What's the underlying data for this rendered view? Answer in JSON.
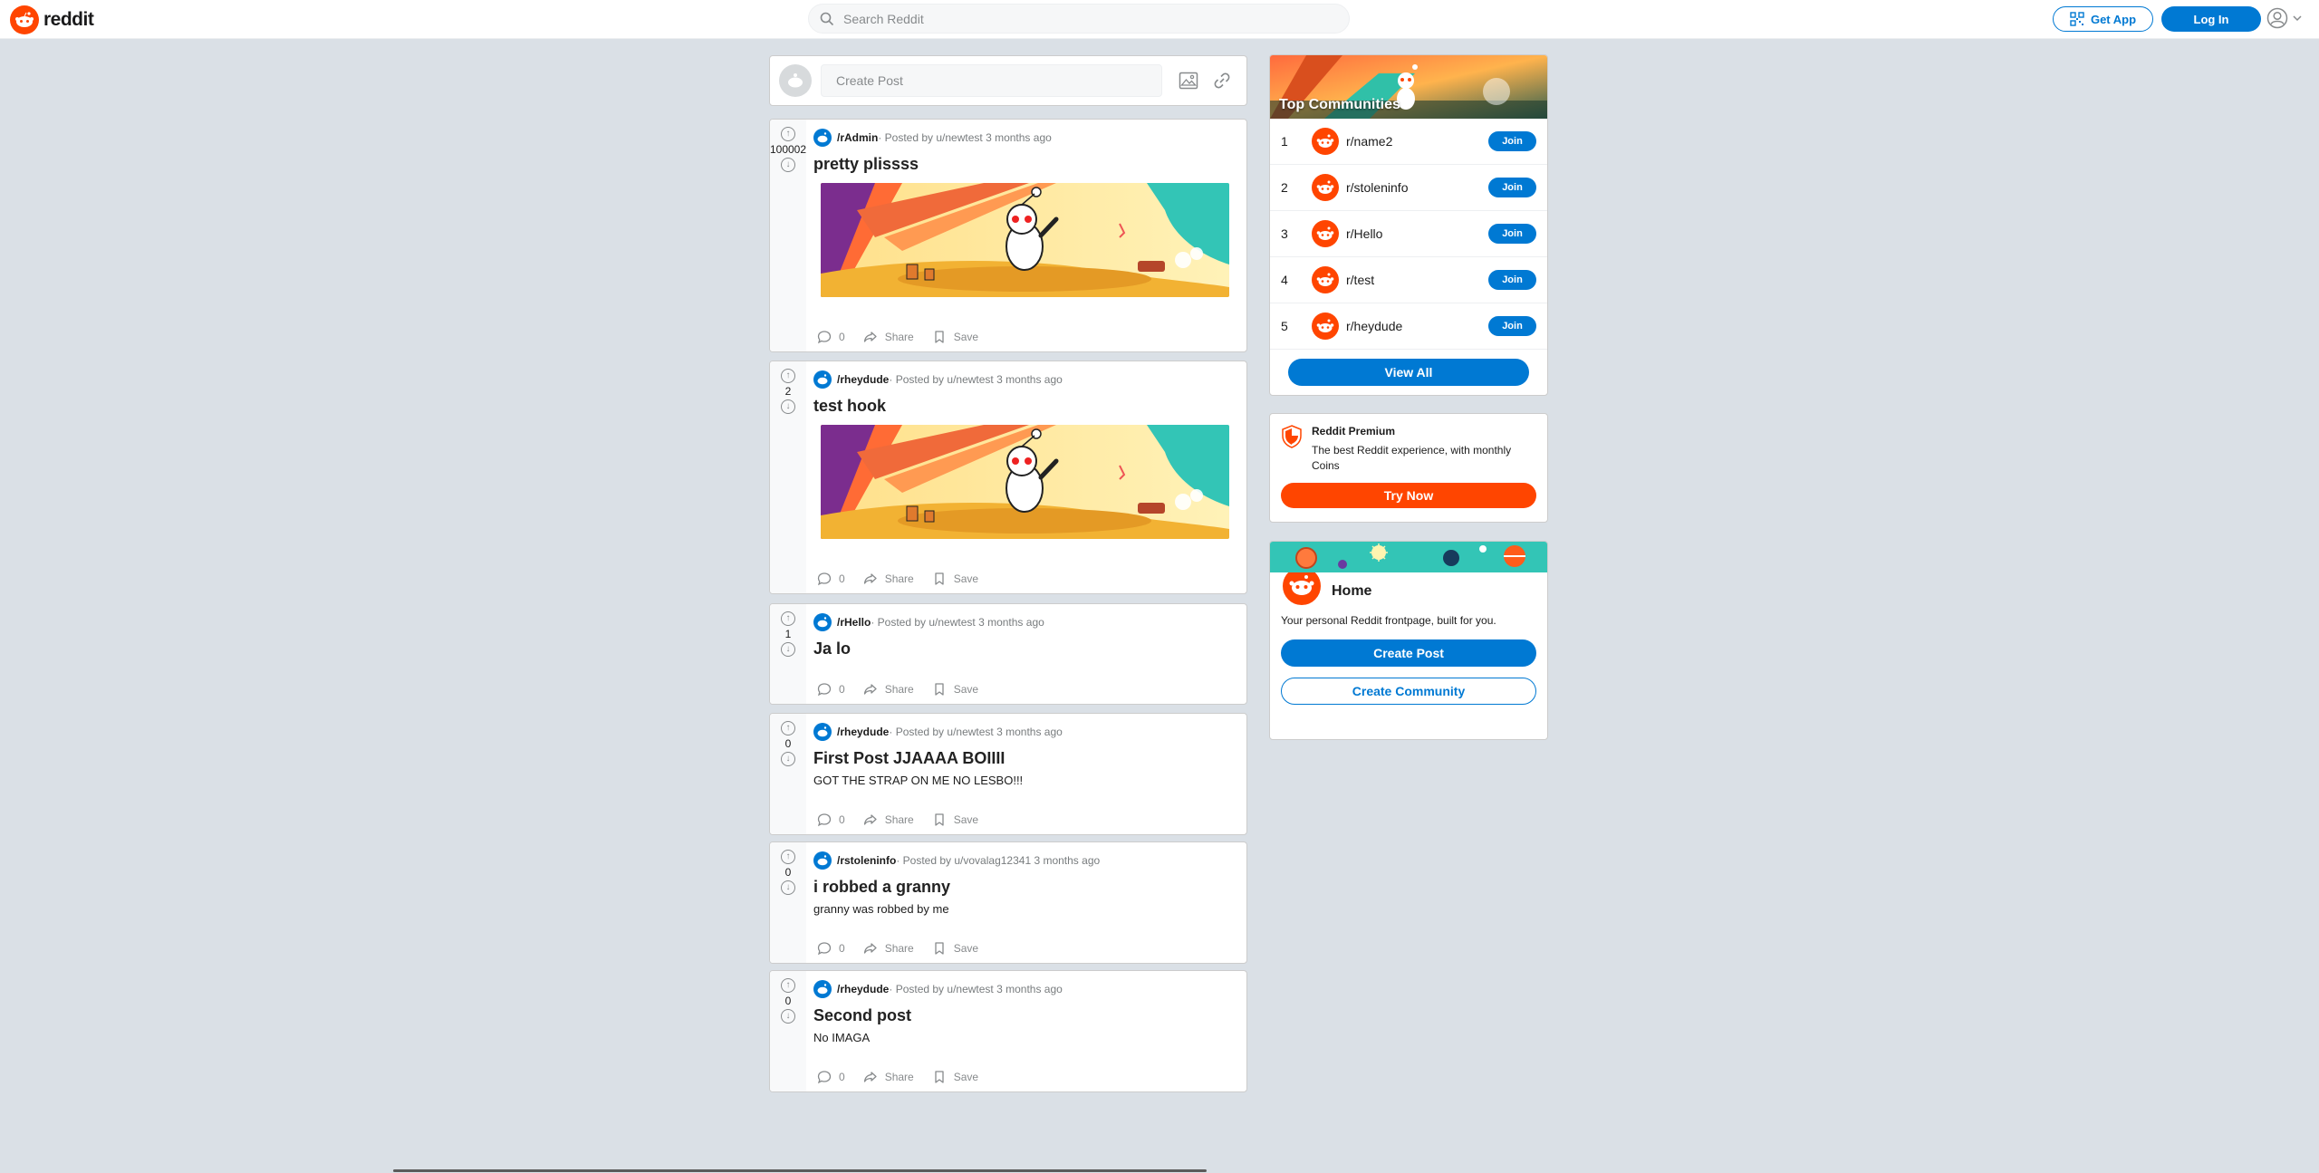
{
  "header": {
    "logo_text": "reddit",
    "search_placeholder": "Search Reddit",
    "get_app_label": "Get App",
    "login_label": "Log In"
  },
  "create_post": {
    "placeholder": "Create Post"
  },
  "posts": [
    {
      "subreddit": "/rAdmin",
      "meta": " · Posted by u/newtest 3 months ago",
      "title": "pretty plissss",
      "text": "",
      "votes": "100002",
      "has_image": true,
      "comments": "0",
      "share": "Share",
      "save": "Save"
    },
    {
      "subreddit": "/rheydude",
      "meta": " · Posted by u/newtest 3 months ago",
      "title": "test hook",
      "text": "",
      "votes": "2",
      "has_image": true,
      "comments": "0",
      "share": "Share",
      "save": "Save"
    },
    {
      "subreddit": "/rHello",
      "meta": " · Posted by u/newtest 3 months ago",
      "title": "Ja lo",
      "text": "",
      "votes": "1",
      "has_image": false,
      "comments": "0",
      "share": "Share",
      "save": "Save"
    },
    {
      "subreddit": "/rheydude",
      "meta": " · Posted by u/newtest 3 months ago",
      "title": "First Post JJAAAA BOIIII",
      "text": "GOT THE STRAP ON ME NO LESBO!!!",
      "votes": "0",
      "has_image": false,
      "comments": "0",
      "share": "Share",
      "save": "Save"
    },
    {
      "subreddit": "/rstoleninfo",
      "meta": " · Posted by u/vovalag12341 3 months ago",
      "title": "i robbed a granny",
      "text": "granny was robbed by me",
      "votes": "0",
      "has_image": false,
      "comments": "0",
      "share": "Share",
      "save": "Save"
    },
    {
      "subreddit": "/rheydude",
      "meta": " · Posted by u/newtest 3 months ago",
      "title": "Second post",
      "text": "No IMAGA",
      "votes": "0",
      "has_image": false,
      "comments": "0",
      "share": "Share",
      "save": "Save"
    }
  ],
  "top_communities": {
    "title": "Top Communities",
    "items": [
      {
        "rank": "1",
        "name": "r/name2",
        "join": "Join"
      },
      {
        "rank": "2",
        "name": "r/stoleninfo",
        "join": "Join"
      },
      {
        "rank": "3",
        "name": "r/Hello",
        "join": "Join"
      },
      {
        "rank": "4",
        "name": "r/test",
        "join": "Join"
      },
      {
        "rank": "5",
        "name": "r/heydude",
        "join": "Join"
      }
    ],
    "view_all": "View All"
  },
  "premium": {
    "title": "Reddit Premium",
    "desc": "The best Reddit experience, with monthly Coins",
    "button": "Try Now"
  },
  "home": {
    "title": "Home",
    "desc": "Your personal Reddit frontpage, built for you.",
    "create_post": "Create Post",
    "create_community": "Create Community"
  },
  "colors": {
    "brand": "#ff4500",
    "accent": "#0079d3",
    "background": "#dae0e6"
  }
}
